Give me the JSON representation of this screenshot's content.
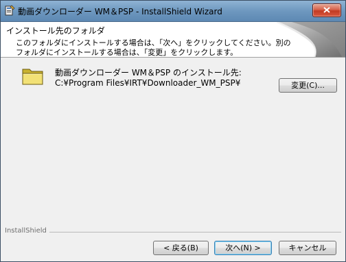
{
  "window": {
    "title": "動画ダウンローダー WM＆PSP - InstallShield Wizard"
  },
  "header": {
    "title": "インストール先のフォルダ",
    "description": "このフォルダにインストールする場合は、「次へ」をクリックしてください。別のフォルダにインストールする場合は、「変更」をクリックします。"
  },
  "destination": {
    "label": "動画ダウンローダー WM＆PSP のインストール先:",
    "path": "C:¥Program Files¥IRT¥Downloader_WM_PSP¥",
    "change_label": "変更(C)..."
  },
  "footer": {
    "brand": "InstallShield",
    "back_label": "< 戻る(B)",
    "next_label": "次へ(N) >",
    "cancel_label": "キャンセル"
  }
}
